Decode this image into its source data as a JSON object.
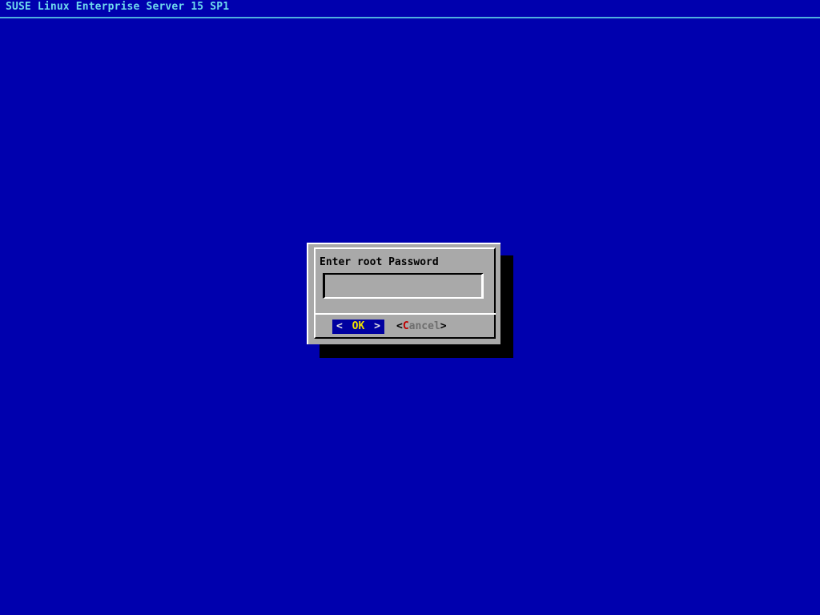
{
  "titlebar": {
    "title": "SUSE Linux Enterprise Server 15 SP1"
  },
  "dialog": {
    "title": "Enter root Password",
    "password_field": {
      "value": ""
    },
    "ok_button": {
      "bracket_left": "<",
      "label": "OK",
      "bracket_right": ">"
    },
    "cancel_button": {
      "bracket_left": "<",
      "shortcut": "C",
      "label_rest": "ancel",
      "bracket_right": ">"
    }
  },
  "colors": {
    "desktop-blue": "#0000AE",
    "titlebar-text": "#6FDBEE",
    "titlebar-line": "#4FB0DF",
    "dialog-gray": "#A9A9A9",
    "shadow-black": "#000000",
    "frame-light": "#FFFFFF",
    "frame-dark": "#000000",
    "ok-bg": "#0000A0",
    "ok-text": "#EFE000",
    "ok-brackets": "#E6E6E6",
    "cancel-shortcut": "#BE0000",
    "cancel-text": "#6E6E6E",
    "dialog-text": "#000000"
  }
}
